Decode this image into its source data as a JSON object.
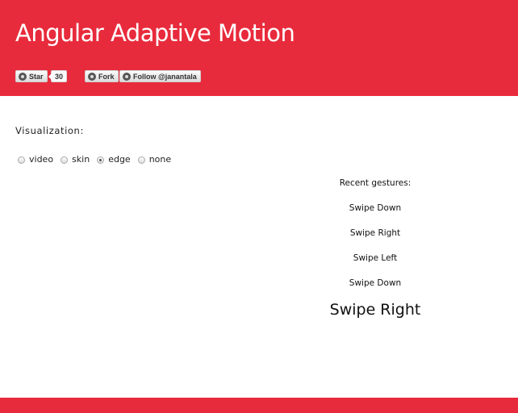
{
  "header": {
    "title": "Angular Adaptive Motion",
    "background": "#e82b3c",
    "buttons": {
      "star_label": "Star",
      "star_count": "30",
      "fork_label": "Fork",
      "follow_label": "Follow @janantala"
    }
  },
  "visualization": {
    "label": "Visualization:",
    "options": [
      {
        "label": "video",
        "checked": false
      },
      {
        "label": "skin",
        "checked": false
      },
      {
        "label": "edge",
        "checked": true
      },
      {
        "label": "none",
        "checked": false
      }
    ]
  },
  "gestures": {
    "heading": "Recent gestures:",
    "recent": [
      "Swipe Down",
      "Swipe Right",
      "Swipe Left",
      "Swipe Down"
    ],
    "current": "Swipe Right"
  }
}
